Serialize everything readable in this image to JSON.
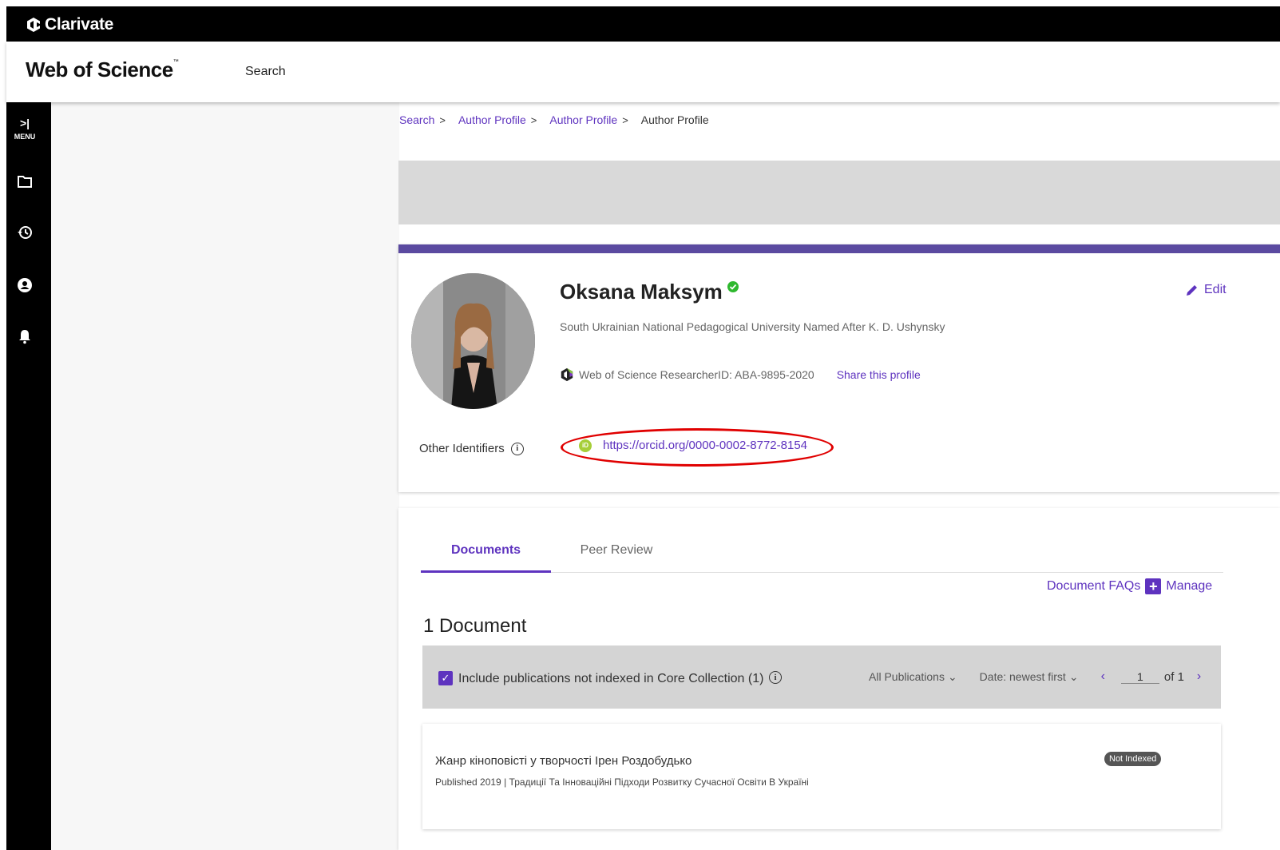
{
  "brand": {
    "name": "Clarivate"
  },
  "appbar": {
    "title": "Web of Science",
    "title_mark": "™",
    "search_label": "Search"
  },
  "sidenav": {
    "menu_label": "MENU",
    "items": [
      {
        "icon": "folder-icon"
      },
      {
        "icon": "history-icon"
      },
      {
        "icon": "user-icon"
      },
      {
        "icon": "bell-icon"
      }
    ]
  },
  "breadcrumb": {
    "items": [
      "Search",
      "Author Profile",
      "Author Profile"
    ],
    "separator": ">",
    "current": "Author Profile"
  },
  "profile": {
    "name": "Oksana Maksym",
    "affiliation": "South Ukrainian National Pedagogical University Named After K. D. Ushynsky",
    "researcher_id": "Web of Science ResearcherID: ABA-9895-2020",
    "share_label": "Share this profile",
    "edit_label": "Edit",
    "other_identifiers_label": "Other Identifiers",
    "orcid_url": "https://orcid.org/0000-0002-8772-8154",
    "accent_color": "#5b4aa0"
  },
  "documents": {
    "tabs": [
      "Documents",
      "Peer Review"
    ],
    "faq_label": "Document FAQs",
    "manage_label": "Manage",
    "count_label": "1 Document",
    "include_label": "Include publications not indexed in Core Collection (1)",
    "filter_label": "All Publications",
    "sort_label": "Date: newest first",
    "page_value": "1",
    "page_total": "of 1",
    "items": [
      {
        "title": "Жанр кіноповісті у творчості Ірен Роздобудько",
        "meta_published": "Published 2019",
        "meta_source": "Традиції Та Інноваційні Підходи Розвитку Сучасної Освіти В Україні",
        "badge": "Not Indexed"
      }
    ]
  }
}
